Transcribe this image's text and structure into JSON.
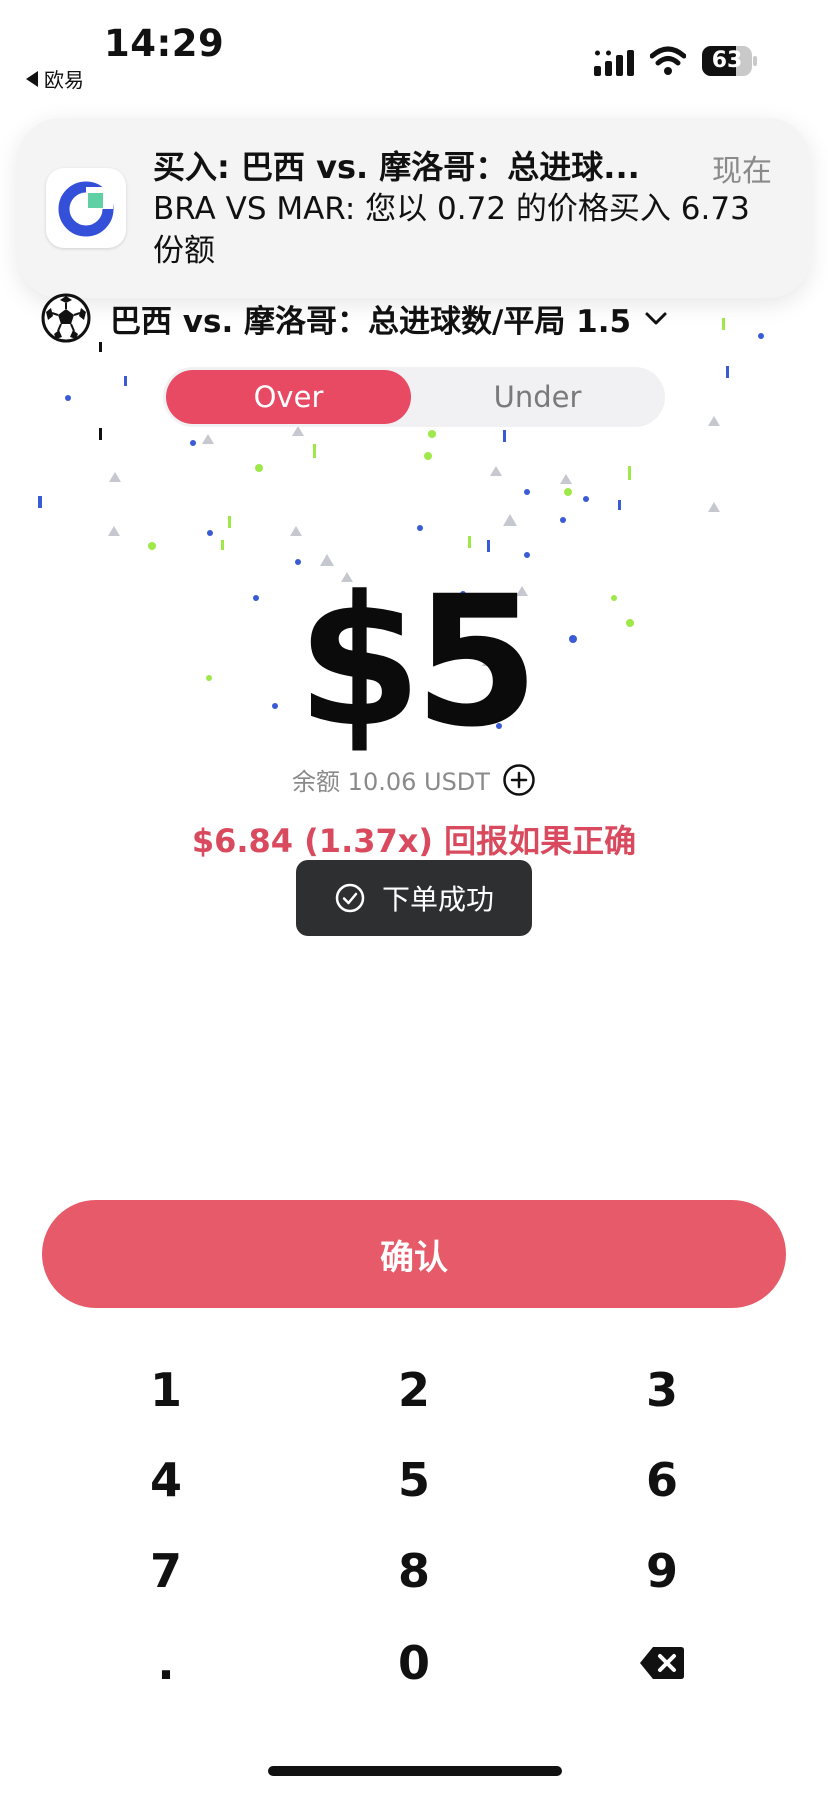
{
  "status_bar": {
    "time": "14:29",
    "back_app": "欧易",
    "battery": "63",
    "icons": [
      "signal-icon",
      "wifi-icon",
      "battery-icon"
    ]
  },
  "notification": {
    "title": "买入: 巴西 vs. 摩洛哥：总进球...",
    "time": "现在",
    "body": "BRA VS MAR: 您以 0.72 的价格买入 6.73 份额",
    "icon": "app-logo-icon"
  },
  "market": {
    "title": "巴西 vs. 摩洛哥：总进球数/平局 1.5",
    "icon": "soccer-ball-icon"
  },
  "toggle": {
    "options": [
      "Over",
      "Under"
    ],
    "selected": "Over"
  },
  "amount": "$5",
  "balance": "余额 10.06 USDT",
  "payout": "$6.84 (1.37x) 回报如果正确",
  "toast": "下单成功",
  "confirm_label": "确认",
  "keypad": {
    "keys": [
      "1",
      "2",
      "3",
      "4",
      "5",
      "6",
      "7",
      "8",
      "9",
      ".",
      "0"
    ],
    "backspace_icon": "backspace-icon"
  },
  "colors": {
    "accent": "#e74a62",
    "confirm": "#e65a69",
    "payout": "#d94a5e",
    "toast_bg": "#2e2f31"
  }
}
